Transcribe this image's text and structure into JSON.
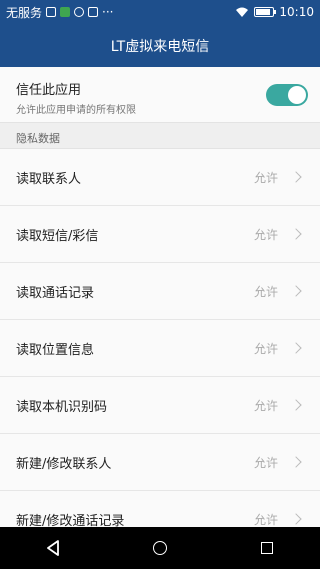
{
  "status_bar": {
    "carrier": "无服务",
    "time": "10:10",
    "icons": [
      "sim-icon",
      "wechat-icon",
      "at-icon",
      "image-icon",
      "more-icon"
    ],
    "overflow_text": "···"
  },
  "app_bar": {
    "title": "LT虚拟来电短信"
  },
  "trust": {
    "title": "信任此应用",
    "subtitle": "允许此应用申请的所有权限",
    "enabled": true
  },
  "section": {
    "title": "隐私数据"
  },
  "permissions": [
    {
      "label": "读取联系人",
      "value": "允许"
    },
    {
      "label": "读取短信/彩信",
      "value": "允许"
    },
    {
      "label": "读取通话记录",
      "value": "允许"
    },
    {
      "label": "读取位置信息",
      "value": "允许"
    },
    {
      "label": "读取本机识别码",
      "value": "允许"
    },
    {
      "label": "新建/修改联系人",
      "value": "允许"
    },
    {
      "label": "新建/修改通话记录",
      "value": "允许"
    }
  ],
  "colors": {
    "primary": "#1e4f8c",
    "toggle_on": "#3aa8a0"
  }
}
